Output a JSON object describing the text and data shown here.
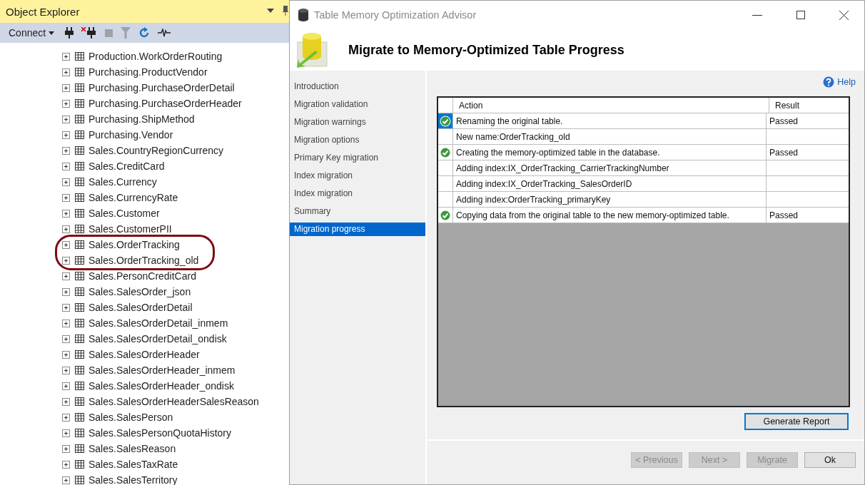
{
  "object_explorer": {
    "title": "Object Explorer",
    "connect": "Connect",
    "items": [
      {
        "label": "Production.WorkOrderRouting",
        "circled": false
      },
      {
        "label": "Purchasing.ProductVendor",
        "circled": false
      },
      {
        "label": "Purchasing.PurchaseOrderDetail",
        "circled": false
      },
      {
        "label": "Purchasing.PurchaseOrderHeader",
        "circled": false
      },
      {
        "label": "Purchasing.ShipMethod",
        "circled": false
      },
      {
        "label": "Purchasing.Vendor",
        "circled": false
      },
      {
        "label": "Sales.CountryRegionCurrency",
        "circled": false
      },
      {
        "label": "Sales.CreditCard",
        "circled": false
      },
      {
        "label": "Sales.Currency",
        "circled": false
      },
      {
        "label": "Sales.CurrencyRate",
        "circled": false
      },
      {
        "label": "Sales.Customer",
        "circled": false
      },
      {
        "label": "Sales.CustomerPII",
        "circled": false
      },
      {
        "label": "Sales.OrderTracking",
        "circled": true
      },
      {
        "label": "Sales.OrderTracking_old",
        "circled": true
      },
      {
        "label": "Sales.PersonCreditCard",
        "circled": false
      },
      {
        "label": "Sales.SalesOrder_json",
        "circled": false
      },
      {
        "label": "Sales.SalesOrderDetail",
        "circled": false
      },
      {
        "label": "Sales.SalesOrderDetail_inmem",
        "circled": false
      },
      {
        "label": "Sales.SalesOrderDetail_ondisk",
        "circled": false
      },
      {
        "label": "Sales.SalesOrderHeader",
        "circled": false
      },
      {
        "label": "Sales.SalesOrderHeader_inmem",
        "circled": false
      },
      {
        "label": "Sales.SalesOrderHeader_ondisk",
        "circled": false
      },
      {
        "label": "Sales.SalesOrderHeaderSalesReason",
        "circled": false
      },
      {
        "label": "Sales.SalesPerson",
        "circled": false
      },
      {
        "label": "Sales.SalesPersonQuotaHistory",
        "circled": false
      },
      {
        "label": "Sales.SalesReason",
        "circled": false
      },
      {
        "label": "Sales.SalesTaxRate",
        "circled": false
      },
      {
        "label": "Sales.SalesTerritory",
        "circled": false
      }
    ]
  },
  "dialog": {
    "title": "Table Memory Optimization Advisor",
    "heading": "Migrate to Memory-Optimized Table Progress",
    "help": "Help",
    "steps": [
      {
        "label": "Introduction",
        "selected": false
      },
      {
        "label": "Migration validation",
        "selected": false
      },
      {
        "label": "Migration warnings",
        "selected": false
      },
      {
        "label": "Migration options",
        "selected": false
      },
      {
        "label": "Primary Key migration",
        "selected": false
      },
      {
        "label": "Index migration",
        "selected": false
      },
      {
        "label": "Index migration",
        "selected": false
      },
      {
        "label": "Summary",
        "selected": false
      },
      {
        "label": "Migration progress",
        "selected": true
      }
    ],
    "table": {
      "columns": [
        "Action",
        "Result"
      ],
      "rows": [
        {
          "passed": true,
          "selected": true,
          "action": "Renaming the original table.",
          "result": "Passed"
        },
        {
          "passed": false,
          "selected": false,
          "action": "New name:OrderTracking_old"
        },
        {
          "passed": true,
          "selected": false,
          "action": "Creating the memory-optimized table in the database.",
          "result": "Passed"
        },
        {
          "passed": false,
          "selected": false,
          "action": "Adding index:IX_OrderTracking_CarrierTrackingNumber"
        },
        {
          "passed": false,
          "selected": false,
          "action": "Adding index:IX_OrderTracking_SalesOrderID"
        },
        {
          "passed": false,
          "selected": false,
          "action": "Adding index:OrderTracking_primaryKey"
        },
        {
          "passed": true,
          "selected": false,
          "action": "Copying data from the original table to the new memory-optimized table.",
          "result": "Passed"
        }
      ]
    },
    "generate_report": "Generate Report",
    "buttons": [
      {
        "label": "< Previous",
        "disabled": true
      },
      {
        "label": "Next >",
        "disabled": true
      },
      {
        "label": "Migrate",
        "disabled": true
      },
      {
        "label": "Ok",
        "disabled": false
      }
    ]
  }
}
